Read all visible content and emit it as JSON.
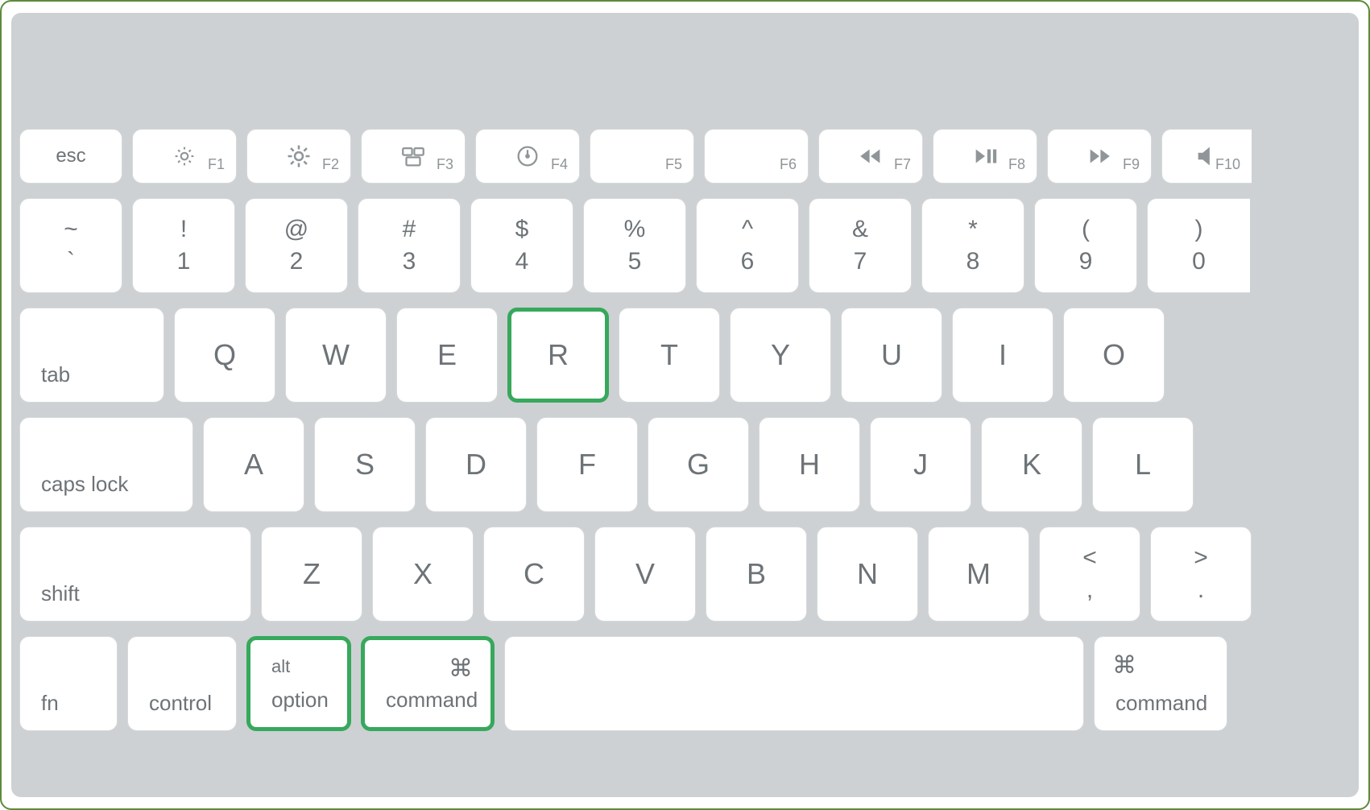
{
  "row_function": {
    "esc": "esc",
    "keys": [
      {
        "icon": "brightness-down",
        "f": "F1"
      },
      {
        "icon": "brightness-up",
        "f": "F2"
      },
      {
        "icon": "mission-control",
        "f": "F3"
      },
      {
        "icon": "dashboard",
        "f": "F4"
      },
      {
        "icon": "",
        "f": "F5"
      },
      {
        "icon": "",
        "f": "F6"
      },
      {
        "icon": "rewind",
        "f": "F7"
      },
      {
        "icon": "play-pause",
        "f": "F8"
      },
      {
        "icon": "forward",
        "f": "F9"
      },
      {
        "icon": "mute",
        "f": "F10"
      }
    ]
  },
  "row_numbers": [
    {
      "top": "~",
      "bottom": "`"
    },
    {
      "top": "!",
      "bottom": "1"
    },
    {
      "top": "@",
      "bottom": "2"
    },
    {
      "top": "#",
      "bottom": "3"
    },
    {
      "top": "$",
      "bottom": "4"
    },
    {
      "top": "%",
      "bottom": "5"
    },
    {
      "top": "^",
      "bottom": "6"
    },
    {
      "top": "&",
      "bottom": "7"
    },
    {
      "top": "*",
      "bottom": "8"
    },
    {
      "top": "(",
      "bottom": "9"
    },
    {
      "top": ")",
      "bottom": "0"
    }
  ],
  "row_qwerty": {
    "tab": "tab",
    "letters": [
      "Q",
      "W",
      "E",
      "R",
      "T",
      "Y",
      "U",
      "I",
      "O"
    ],
    "highlighted": [
      "R"
    ]
  },
  "row_asdf": {
    "caps": "caps lock",
    "letters": [
      "A",
      "S",
      "D",
      "F",
      "G",
      "H",
      "J",
      "K",
      "L"
    ]
  },
  "row_zxcv": {
    "shift": "shift",
    "letters": [
      "Z",
      "X",
      "C",
      "V",
      "B",
      "N",
      "M"
    ],
    "punct": [
      {
        "top": "<",
        "bottom": ","
      },
      {
        "top": ">",
        "bottom": "."
      }
    ]
  },
  "row_bottom": {
    "fn": "fn",
    "control": "control",
    "option_alt": "alt",
    "option": "option",
    "command_sym": "⌘",
    "command": "command",
    "highlighted": [
      "option",
      "command-left"
    ]
  }
}
